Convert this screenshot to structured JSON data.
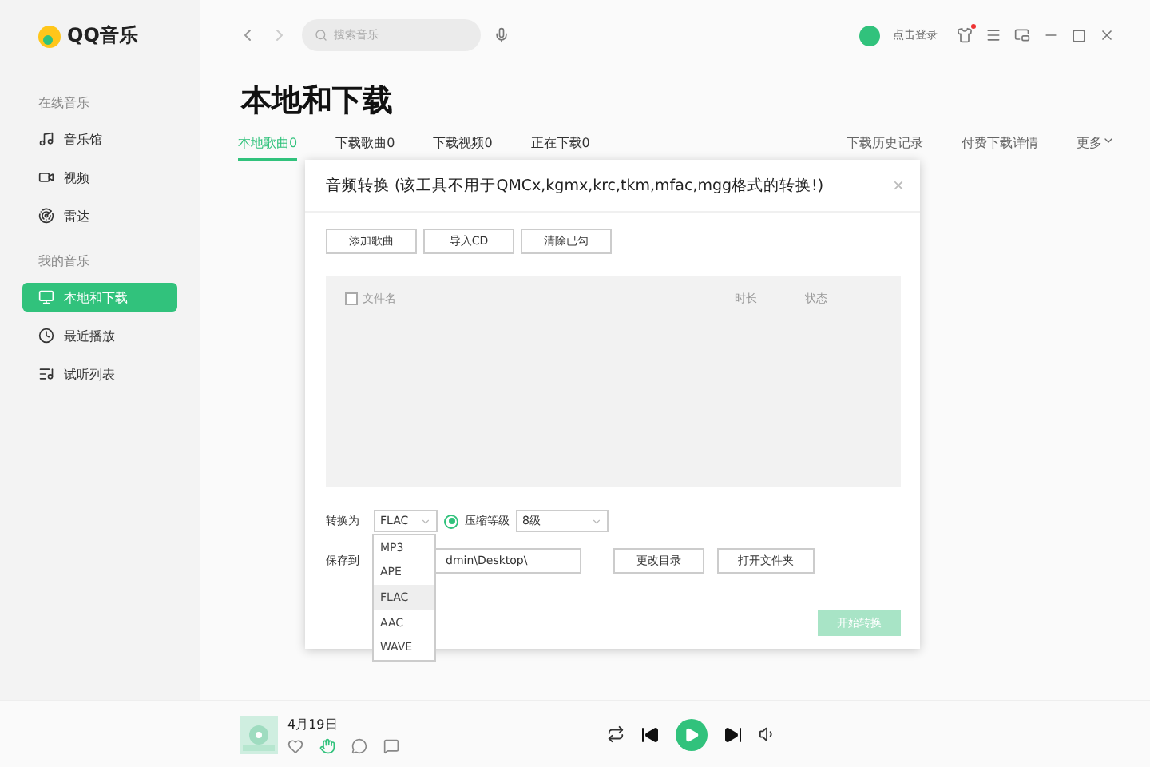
{
  "app": {
    "logo": "QQ音乐"
  },
  "sidebar": {
    "sections": [
      {
        "title": "在线音乐",
        "items": [
          {
            "label": "音乐馆",
            "selected": false
          },
          {
            "label": "视频",
            "selected": false
          },
          {
            "label": "雷达",
            "selected": false
          }
        ]
      },
      {
        "title": "我的音乐",
        "items": [
          {
            "label": "本地和下载",
            "selected": true
          },
          {
            "label": "最近播放",
            "selected": false
          },
          {
            "label": "试听列表",
            "selected": false
          }
        ]
      }
    ]
  },
  "topbar": {
    "search": {
      "placeholder": "搜索音乐"
    },
    "login": "点击登录",
    "notification": true
  },
  "page": {
    "title": "本地和下载",
    "tabs": [
      {
        "label": "本地歌曲0",
        "selected": true
      },
      {
        "label": "下载歌曲0",
        "selected": false
      },
      {
        "label": "下载视频0",
        "selected": false
      },
      {
        "label": "正在下载0",
        "selected": false
      }
    ],
    "links": [
      "下载历史记录",
      "付费下载详情"
    ],
    "more": "更多"
  },
  "dialog": {
    "title": "音频转换 (该工具不用于QMCx,kgmx,krc,tkm,mfac,mgg格式的转换!)",
    "close": "×",
    "buttons": [
      "添加歌曲",
      "导入CD",
      "清除已勾"
    ],
    "columns": [
      "文件名",
      "时长",
      "状态"
    ],
    "select_all": false,
    "convert_label": "转换为",
    "format": "FLAC",
    "compress": {
      "label": "压缩等级",
      "checked": true,
      "value": "8级"
    },
    "save_label": "保存到",
    "save_path": "dmin\\Desktop\\",
    "path_buttons": [
      "更改目录",
      "打开文件夹"
    ],
    "start": {
      "label": "开始转换",
      "disabled": true
    },
    "format_options": [
      {
        "label": "MP3",
        "selected": false
      },
      {
        "label": "APE",
        "selected": false
      },
      {
        "label": "FLAC",
        "selected": true
      },
      {
        "label": "AAC",
        "selected": false
      },
      {
        "label": "WAVE",
        "selected": false
      }
    ]
  },
  "player": {
    "song": "4月19日",
    "liked": false,
    "playing": false
  }
}
